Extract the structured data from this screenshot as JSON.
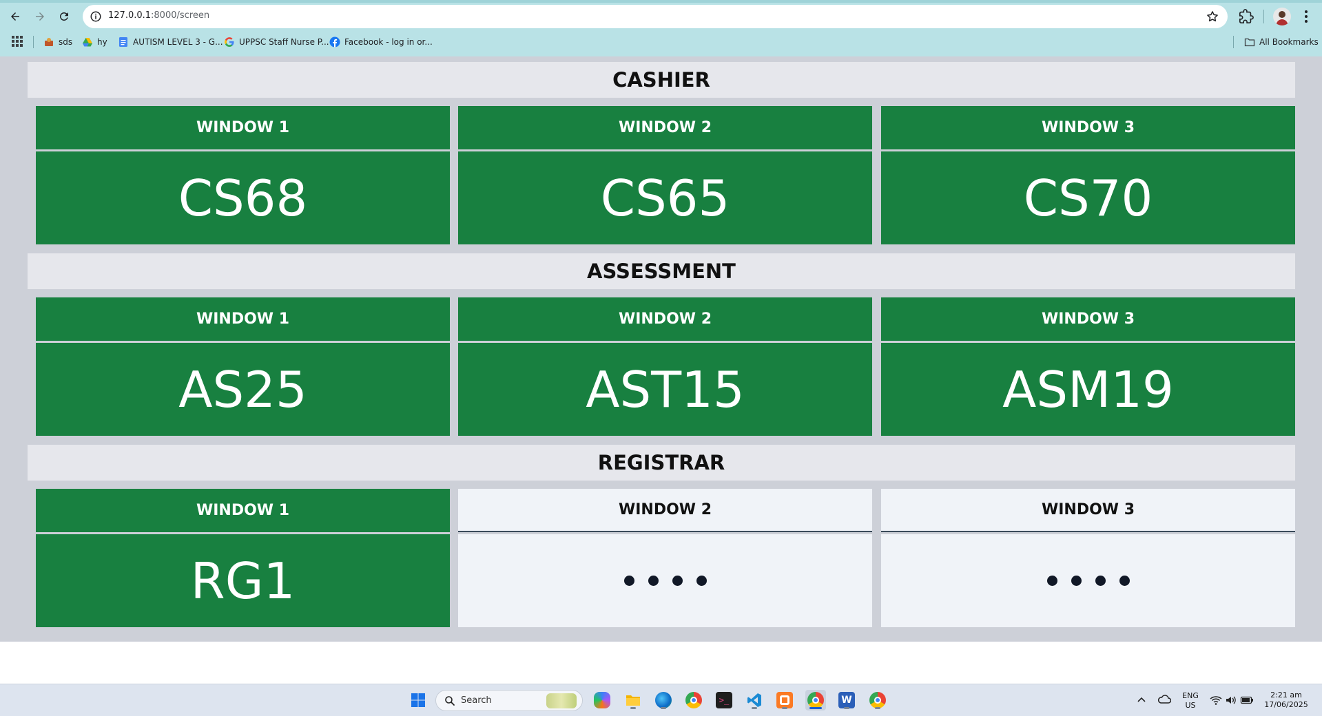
{
  "browser": {
    "url_host": "127.0.0.1",
    "url_rest": ":8000/screen",
    "bookmarks": [
      {
        "label": "sds",
        "icon": "bookmark-favicon-icon"
      },
      {
        "label": "hy",
        "icon": "google-drive-icon"
      },
      {
        "label": "AUTISM LEVEL 3 - G...",
        "icon": "google-docs-icon"
      },
      {
        "label": "UPPSC Staff Nurse P...",
        "icon": "google-icon"
      },
      {
        "label": "Facebook - log in or...",
        "icon": "facebook-icon"
      }
    ],
    "all_bookmarks_label": "All Bookmarks"
  },
  "colors": {
    "active_card": "#188040",
    "idle_card": "#f0f3f8",
    "section_header": "#e6e7ec",
    "page_background": "#cdd0d8"
  },
  "sections": [
    {
      "title": "CASHIER",
      "windows": [
        {
          "label": "WINDOW 1",
          "number": "CS68",
          "status": "active"
        },
        {
          "label": "WINDOW 2",
          "number": "CS65",
          "status": "active"
        },
        {
          "label": "WINDOW 3",
          "number": "CS70",
          "status": "active"
        }
      ]
    },
    {
      "title": "ASSESSMENT",
      "windows": [
        {
          "label": "WINDOW 1",
          "number": "AS25",
          "status": "active"
        },
        {
          "label": "WINDOW 2",
          "number": "AST15",
          "status": "active"
        },
        {
          "label": "WINDOW 3",
          "number": "ASM19",
          "status": "active"
        }
      ]
    },
    {
      "title": "REGISTRAR",
      "windows": [
        {
          "label": "WINDOW 1",
          "number": "RG1",
          "status": "active"
        },
        {
          "label": "WINDOW 2",
          "number": "",
          "status": "idle"
        },
        {
          "label": "WINDOW 3",
          "number": "",
          "status": "idle"
        }
      ]
    }
  ],
  "taskbar": {
    "search_label": "Search",
    "language_line1": "ENG",
    "language_line2": "US",
    "time": "2:21 am",
    "date": "17/06/2025"
  }
}
